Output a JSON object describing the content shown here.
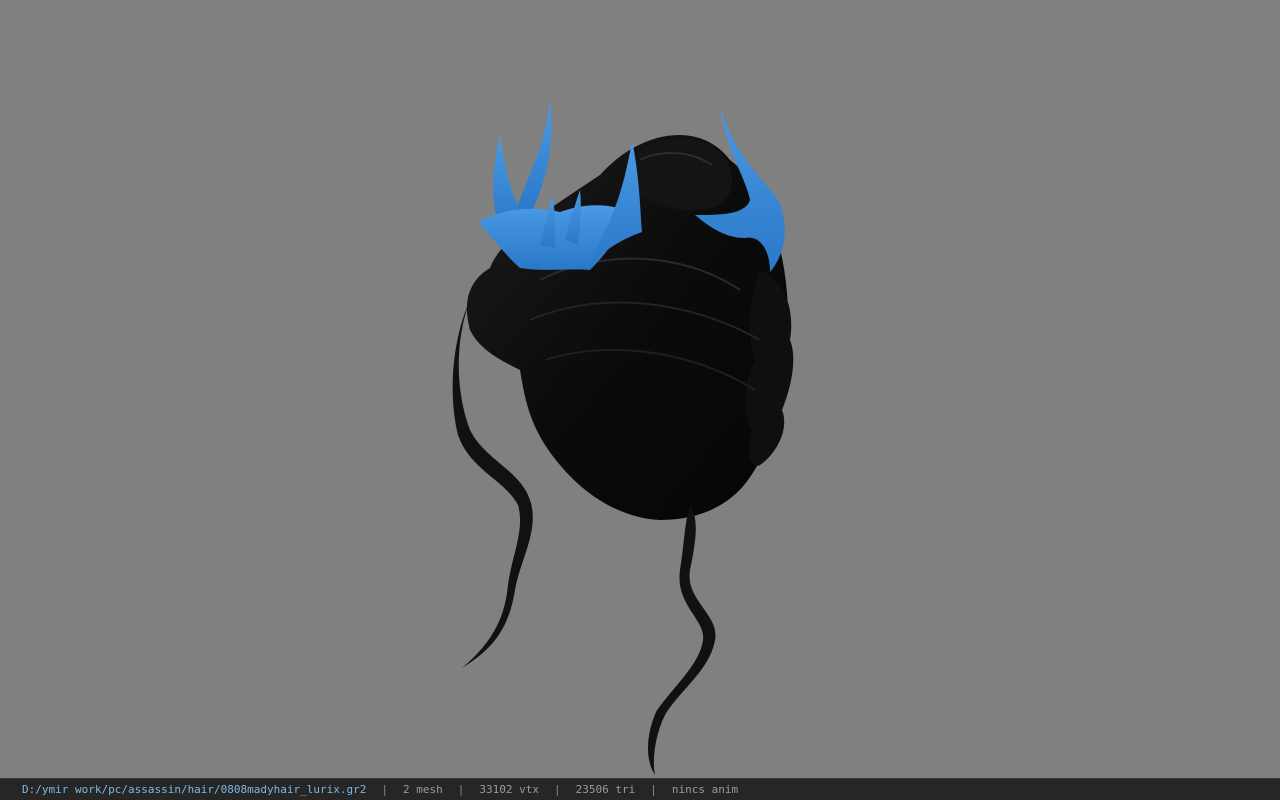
{
  "viewport": {
    "background_color": "#808080",
    "model": {
      "hair_color": "#0c0c0c",
      "crown_color": "#3a8ad8"
    }
  },
  "statusbar": {
    "file_path": "D:/ymir work/pc/assassin/hair/0808madyhair_lurix.gr2",
    "separator": "|",
    "mesh": "2 mesh",
    "vtx": "33102 vtx",
    "tri": "23506 tri",
    "anim": "nincs anim"
  }
}
